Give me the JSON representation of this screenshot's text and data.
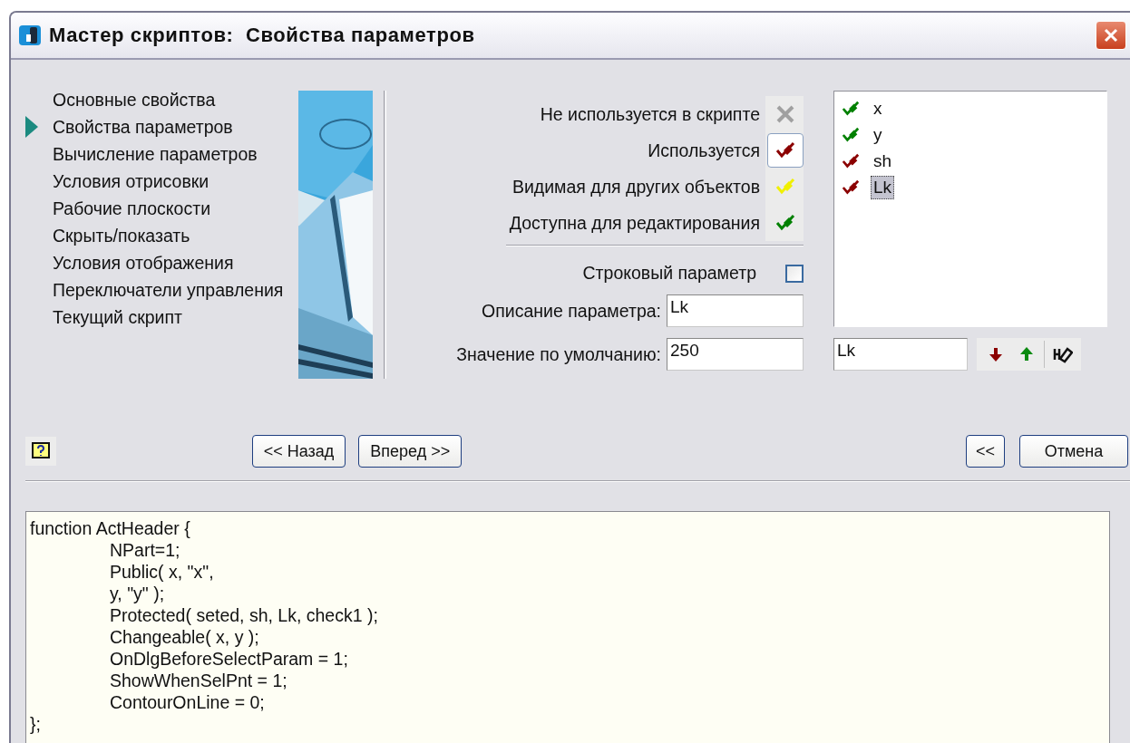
{
  "window": {
    "title": "Мастер скриптов:  Свойства параметров"
  },
  "steps": [
    {
      "label": "Основные свойства",
      "selected": false
    },
    {
      "label": "Свойства параметров",
      "selected": true
    },
    {
      "label": "Вычисление параметров",
      "selected": false
    },
    {
      "label": "Условия отрисовки",
      "selected": false
    },
    {
      "label": "Рабочие плоскости",
      "selected": false
    },
    {
      "label": "Скрыть/показать",
      "selected": false
    },
    {
      "label": "Условия отображения",
      "selected": false
    },
    {
      "label": "Переключатели управления",
      "selected": false
    },
    {
      "label": "Текущий скрипт",
      "selected": false
    }
  ],
  "usage_options": [
    {
      "label": "Не используется в скрипте",
      "kind": "cross",
      "selected": false
    },
    {
      "label": "Используется",
      "kind": "check",
      "color": "#8b0000",
      "selected": true
    },
    {
      "label": "Видимая для других объектов",
      "kind": "check",
      "color": "#f0f000",
      "selected": false
    },
    {
      "label": "Доступна для редактирования",
      "kind": "check",
      "color": "#008000",
      "selected": false
    }
  ],
  "string_param": {
    "label": "Строковый параметр",
    "checked": false
  },
  "description": {
    "label": "Описание параметра:",
    "value": "Lk"
  },
  "default_value": {
    "label": "Значение по умолчанию:",
    "value": "250"
  },
  "parameters": [
    {
      "name": "x",
      "color": "#008000",
      "selected": false
    },
    {
      "name": "y",
      "color": "#008000",
      "selected": false
    },
    {
      "name": "sh",
      "color": "#8b0000",
      "selected": false
    },
    {
      "name": "Lk",
      "color": "#8b0000",
      "selected": true
    }
  ],
  "rename_field": {
    "value": "Lk"
  },
  "buttons": {
    "back": "<< Назад",
    "next": "Вперед >>",
    "collapse": "<<",
    "cancel": "Отмена"
  },
  "code": {
    "header": "function ActHeader {",
    "body": [
      "NPart=1;",
      "Public( x, \"x\",",
      "y, \"y\" );",
      "Protected( seted, sh, Lk, check1 );",
      "Changeable( x, y );",
      "OnDlgBeforeSelectParam = 1;",
      "ShowWhenSelPnt = 1;",
      "ContourOnLine = 0;"
    ],
    "footer": "};"
  }
}
